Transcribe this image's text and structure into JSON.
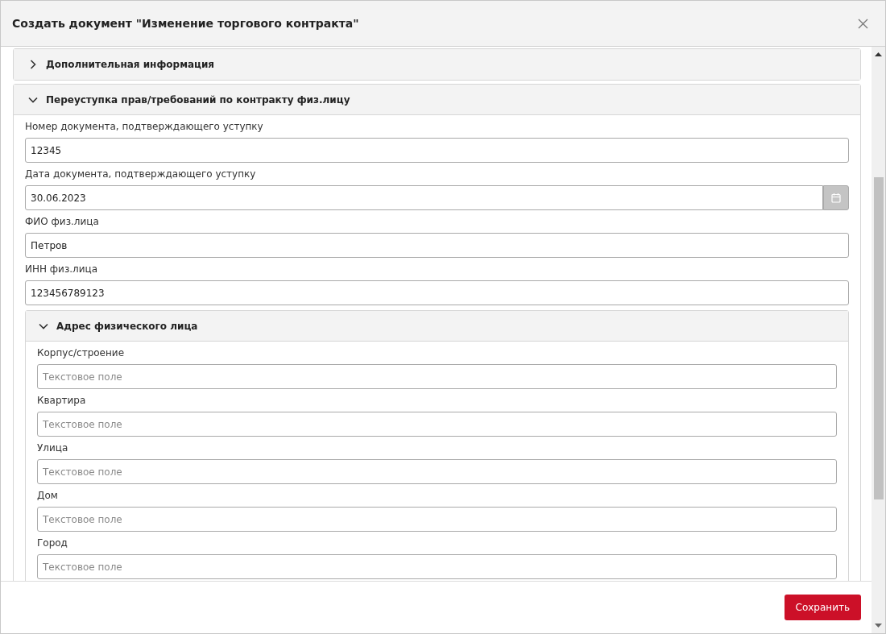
{
  "dialog": {
    "title": "Создать документ \"Изменение торгового контракта\""
  },
  "sections": [
    {
      "title": "Дополнительная информация",
      "expanded": false
    },
    {
      "title": "Переуступка прав/требований по контракту физ.лицу",
      "expanded": true,
      "fields": [
        {
          "kind": "text",
          "label": "Номер документа, подтверждающего уступку",
          "value": "12345"
        },
        {
          "kind": "date",
          "label": "Дата документа, подтверждающего уступку",
          "value": "30.06.2023"
        },
        {
          "kind": "text",
          "label": "ФИО физ.лица",
          "value": "Петров"
        },
        {
          "kind": "text",
          "label": "ИНН физ.лица",
          "value": "123456789123"
        }
      ],
      "subsections": [
        {
          "title": "Адрес физического лица",
          "expanded": true,
          "fields": [
            {
              "kind": "text",
              "label": "Корпус/строение",
              "placeholder": "Текстовое поле"
            },
            {
              "kind": "text",
              "label": "Квартира",
              "placeholder": "Текстовое поле"
            },
            {
              "kind": "text",
              "label": "Улица",
              "placeholder": "Текстовое поле"
            },
            {
              "kind": "text",
              "label": "Дом",
              "placeholder": "Текстовое поле"
            },
            {
              "kind": "text",
              "label": "Город",
              "placeholder": "Текстовое поле"
            }
          ]
        }
      ]
    }
  ],
  "footer": {
    "save_button": "Сохранить"
  }
}
